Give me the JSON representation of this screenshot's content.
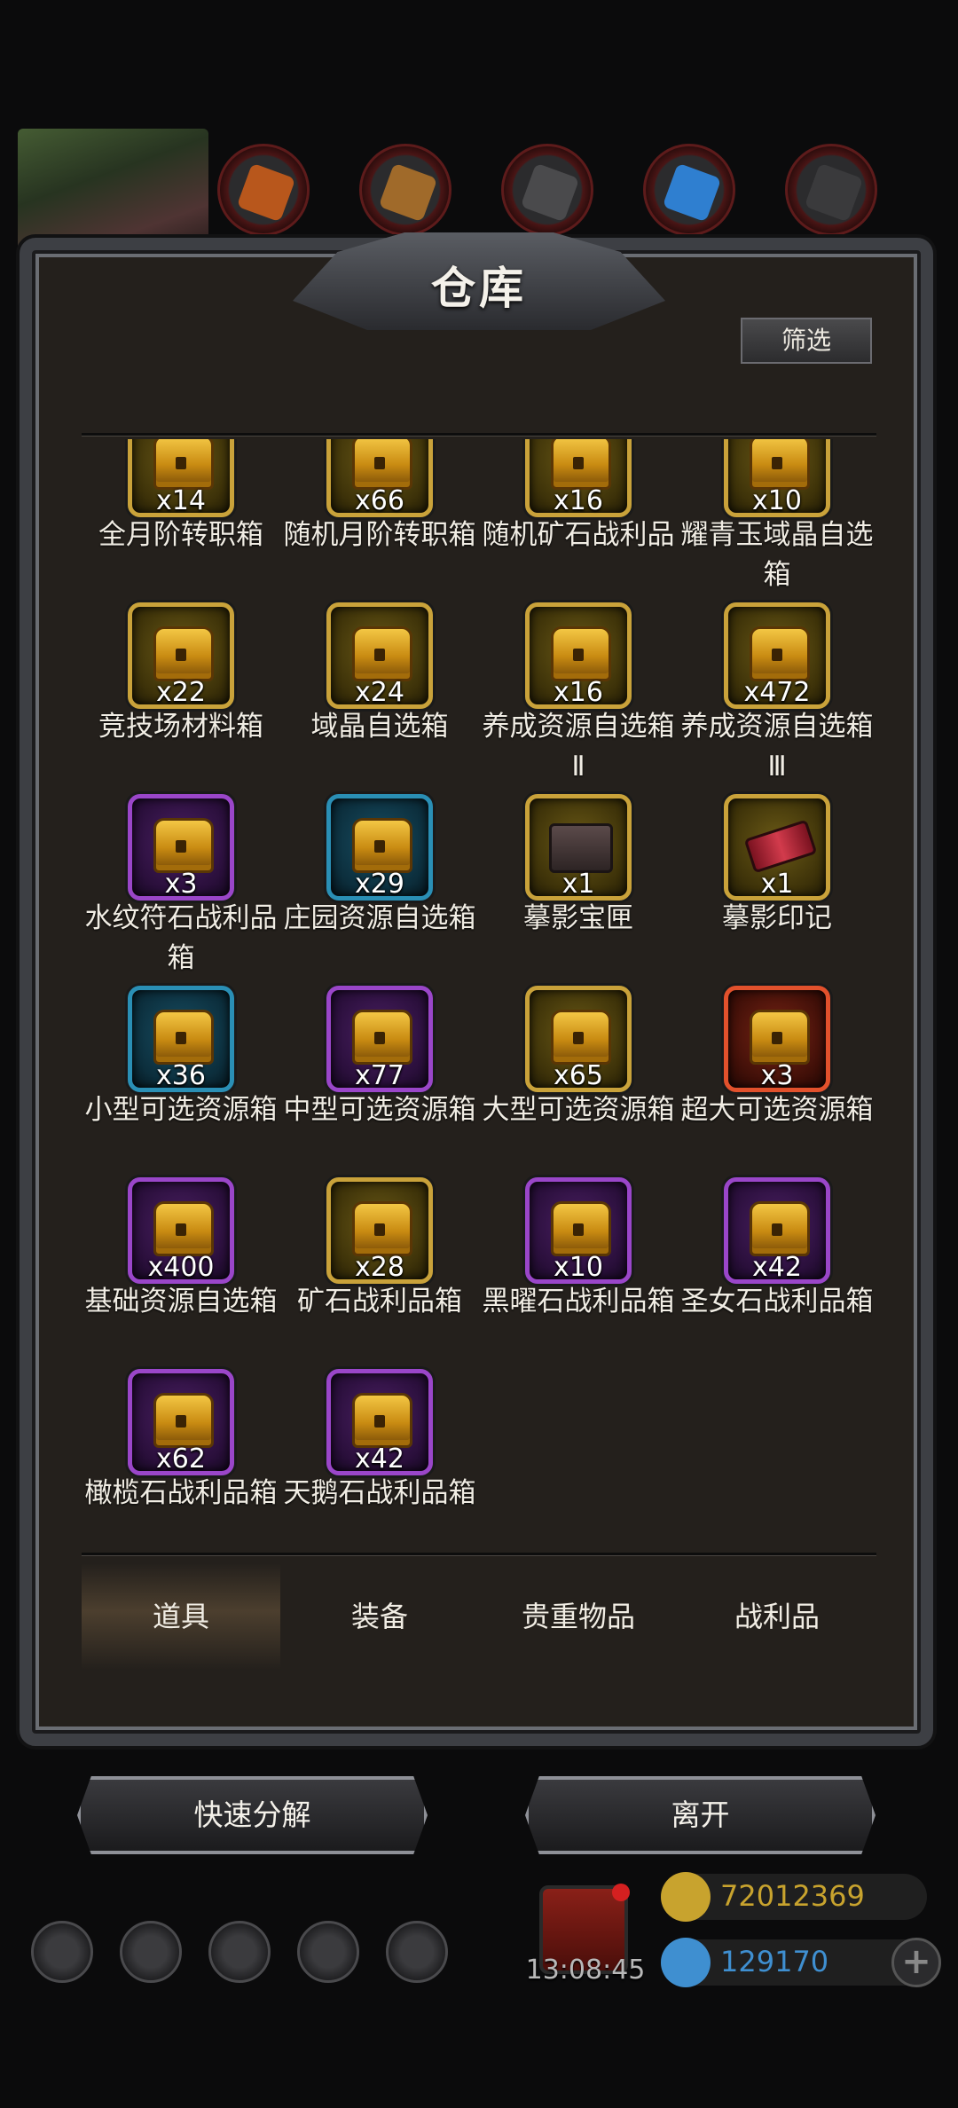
{
  "window": {
    "title": "仓库",
    "filter_label": "筛选"
  },
  "items": [
    {
      "name": "全月阶转职箱",
      "qty": "x14",
      "rarity": "gold",
      "kind": "chest"
    },
    {
      "name": "随机月阶转职箱",
      "qty": "x66",
      "rarity": "gold",
      "kind": "chest"
    },
    {
      "name": "随机矿石战利品",
      "qty": "x16",
      "rarity": "gold",
      "kind": "chest"
    },
    {
      "name": "耀青玉域晶自选箱",
      "qty": "x10",
      "rarity": "gold",
      "kind": "chest"
    },
    {
      "name": "竞技场材料箱",
      "qty": "x22",
      "rarity": "gold",
      "kind": "chest"
    },
    {
      "name": "域晶自选箱",
      "qty": "x24",
      "rarity": "gold",
      "kind": "chest"
    },
    {
      "name": "养成资源自选箱Ⅱ",
      "qty": "x16",
      "rarity": "gold",
      "kind": "chest"
    },
    {
      "name": "养成资源自选箱Ⅲ",
      "qty": "x472",
      "rarity": "gold",
      "kind": "chest"
    },
    {
      "name": "水纹符石战利品箱",
      "qty": "x3",
      "rarity": "purple",
      "kind": "chest"
    },
    {
      "name": "庄园资源自选箱",
      "qty": "x29",
      "rarity": "blue",
      "kind": "chest"
    },
    {
      "name": "摹影宝匣",
      "qty": "x1",
      "rarity": "gold",
      "kind": "box"
    },
    {
      "name": "摹影印记",
      "qty": "x1",
      "rarity": "gold",
      "kind": "seal"
    },
    {
      "name": "小型可选资源箱",
      "qty": "x36",
      "rarity": "blue",
      "kind": "chest"
    },
    {
      "name": "中型可选资源箱",
      "qty": "x77",
      "rarity": "purple",
      "kind": "chest"
    },
    {
      "name": "大型可选资源箱",
      "qty": "x65",
      "rarity": "gold",
      "kind": "chest"
    },
    {
      "name": "超大可选资源箱",
      "qty": "x3",
      "rarity": "red",
      "kind": "chest"
    },
    {
      "name": "基础资源自选箱",
      "qty": "x400",
      "rarity": "purple",
      "kind": "chest"
    },
    {
      "name": "矿石战利品箱",
      "qty": "x28",
      "rarity": "gold",
      "kind": "chest"
    },
    {
      "name": "黑曜石战利品箱",
      "qty": "x10",
      "rarity": "purple",
      "kind": "chest"
    },
    {
      "name": "圣女石战利品箱",
      "qty": "x42",
      "rarity": "purple",
      "kind": "chest"
    },
    {
      "name": "橄榄石战利品箱",
      "qty": "x62",
      "rarity": "purple",
      "kind": "chest"
    },
    {
      "name": "天鹅石战利品箱",
      "qty": "x42",
      "rarity": "purple",
      "kind": "chest"
    }
  ],
  "tabs": [
    {
      "label": "道具",
      "active": true
    },
    {
      "label": "装备",
      "active": false
    },
    {
      "label": "贵重物品",
      "active": false
    },
    {
      "label": "战利品",
      "active": false
    }
  ],
  "actions": {
    "decompose": "快速分解",
    "leave": "离开"
  },
  "hud": {
    "timer": "13:08:45",
    "gold": "72012369",
    "gems": "129170",
    "gold_color": "#c8a32e",
    "gem_color": "#3f8fd0"
  }
}
